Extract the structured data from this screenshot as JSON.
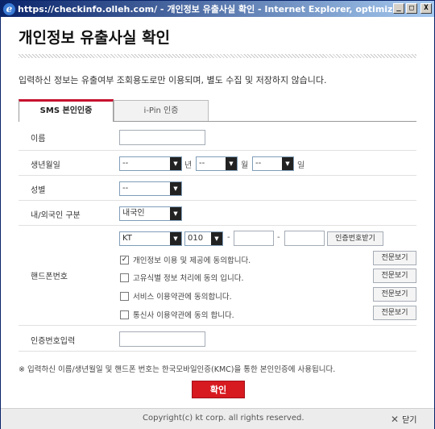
{
  "window": {
    "title": "https://checkinfo.olleh.com/ - 개인정보 유출사실 확인 - Internet Explorer, optimiz…",
    "btn_min": "_",
    "btn_max": "□",
    "btn_close": "X",
    "logo": "e"
  },
  "page": {
    "title": "개인정보 유출사실 확인",
    "notice": "입력하신 정보는 유출여부 조회용도로만 이용되며, 별도 수집 및 저장하지 않습니다."
  },
  "tabs": [
    {
      "label": "SMS 본인인증",
      "active": true
    },
    {
      "label": "i-Pin 인증",
      "active": false
    }
  ],
  "form": {
    "name_label": "이름",
    "name_value": "",
    "birth_label": "생년월일",
    "birth_year": "--",
    "birth_year_unit": "년",
    "birth_month": "--",
    "birth_month_unit": "월",
    "birth_day": "--",
    "birth_day_unit": "일",
    "gender_label": "성별",
    "gender_value": "--",
    "nationality_label": "내/외국인 구분",
    "nationality_value": "내국인",
    "phone_label": "핸드폰번호",
    "carrier_value": "KT",
    "prefix_value": "010",
    "dash": "-",
    "send_code_button": "인증번호받기",
    "consents": [
      {
        "label": "개인정보 이용 및 제공에 동의합니다.",
        "checked": true,
        "view": "전문보기"
      },
      {
        "label": "고유식별 정보 처리에 동의 입니다.",
        "checked": false,
        "view": "전문보기"
      },
      {
        "label": "서비스 이용약관에 동의합니다.",
        "checked": false,
        "view": "전문보기"
      },
      {
        "label": "통신사 이용약관에 동의 합니다.",
        "checked": false,
        "view": "전문보기"
      }
    ],
    "code_label": "인증번호입력",
    "code_value": ""
  },
  "footer": {
    "note": "※ 입력하신 이름/생년월일 및 핸드폰 번호는 한국모바일인증(KMC)을 통한 본인인증에 사용됩니다.",
    "confirm_button": "확인",
    "copyright": "Copyright(c) kt corp. all rights reserved.",
    "close_label": "닫기",
    "close_icon": "✕"
  },
  "colors": {
    "accent_red": "#d71920",
    "titlebar": "#0a246a"
  }
}
